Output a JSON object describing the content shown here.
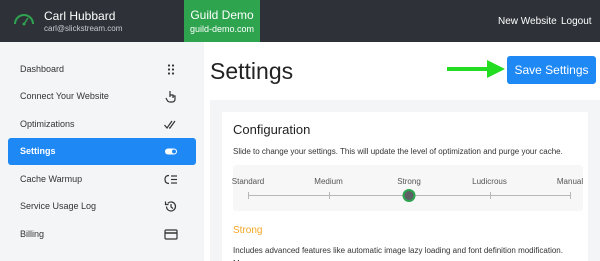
{
  "header": {
    "user_name": "Carl Hubbard",
    "user_email": "carl@slickstream.com",
    "site_title": "Guild Demo",
    "site_domain": "guild-demo.com",
    "new_website_label": "New Website",
    "logout_label": "Logout"
  },
  "sidebar": {
    "items": [
      {
        "label": "Dashboard",
        "icon": "grid-dots-icon"
      },
      {
        "label": "Connect Your Website",
        "icon": "pointer-hand-icon"
      },
      {
        "label": "Optimizations",
        "icon": "double-check-icon"
      },
      {
        "label": "Settings",
        "icon": "toggle-icon",
        "active": true
      },
      {
        "label": "Cache Warmup",
        "icon": "cache-list-icon"
      },
      {
        "label": "Service Usage Log",
        "icon": "history-icon"
      },
      {
        "label": "Billing",
        "icon": "credit-card-icon"
      }
    ]
  },
  "main": {
    "title": "Settings",
    "save_label": "Save Settings"
  },
  "configuration": {
    "title": "Configuration",
    "description": "Slide to change your settings. This will update the level of optimization and purge your cache.",
    "levels": [
      "Standard",
      "Medium",
      "Strong",
      "Ludicrous",
      "Manual"
    ],
    "selected_index": 2,
    "selected_name": "Strong",
    "selected_description": "Includes advanced features like automatic image lazy loading and font definition modification. May"
  },
  "colors": {
    "accent": "#1e88f5",
    "brand_green": "#2ea44f",
    "topbar": "#2e3238",
    "level_highlight": "#f5a623"
  }
}
